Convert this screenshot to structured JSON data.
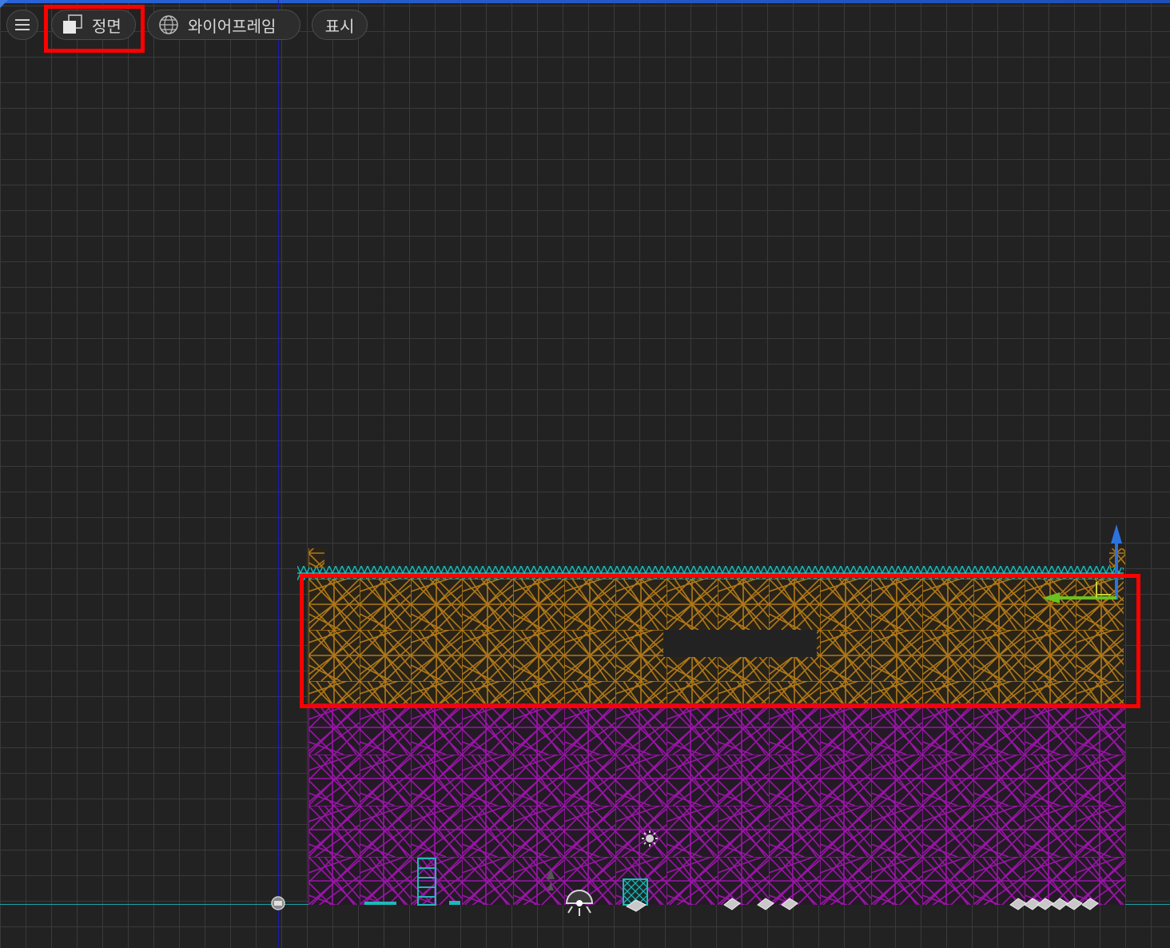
{
  "toolbar": {
    "menu_icon": "hamburger-icon",
    "view_label": "정면",
    "view_icon": "front-view-cube-icon",
    "shading_label": "와이어프레임",
    "shading_icon": "wireframe-globe-icon",
    "show_label": "표시"
  },
  "colors": {
    "grid_background": "#222222",
    "grid_line": "#3a3a3a",
    "vertical_axis": "#1b1bb5",
    "horizontal_axis": "#1aa0a0",
    "wire_cyan": "#1fb8b8",
    "wire_orange": "#b07818",
    "wire_magenta": "#9a14a8",
    "highlight": "#ff0000",
    "gizmo_up": "#2b74e0",
    "gizmo_side": "#6cc020"
  },
  "highlights": [
    "view-dropdown",
    "selected-wall-section"
  ],
  "scene_objects": [
    "wireframe-wall-top-strip",
    "wireframe-wall-upper",
    "wireframe-wall-lower",
    "transform-gizmo",
    "light-icon",
    "camera-icon",
    "reflection-probe-icon"
  ]
}
